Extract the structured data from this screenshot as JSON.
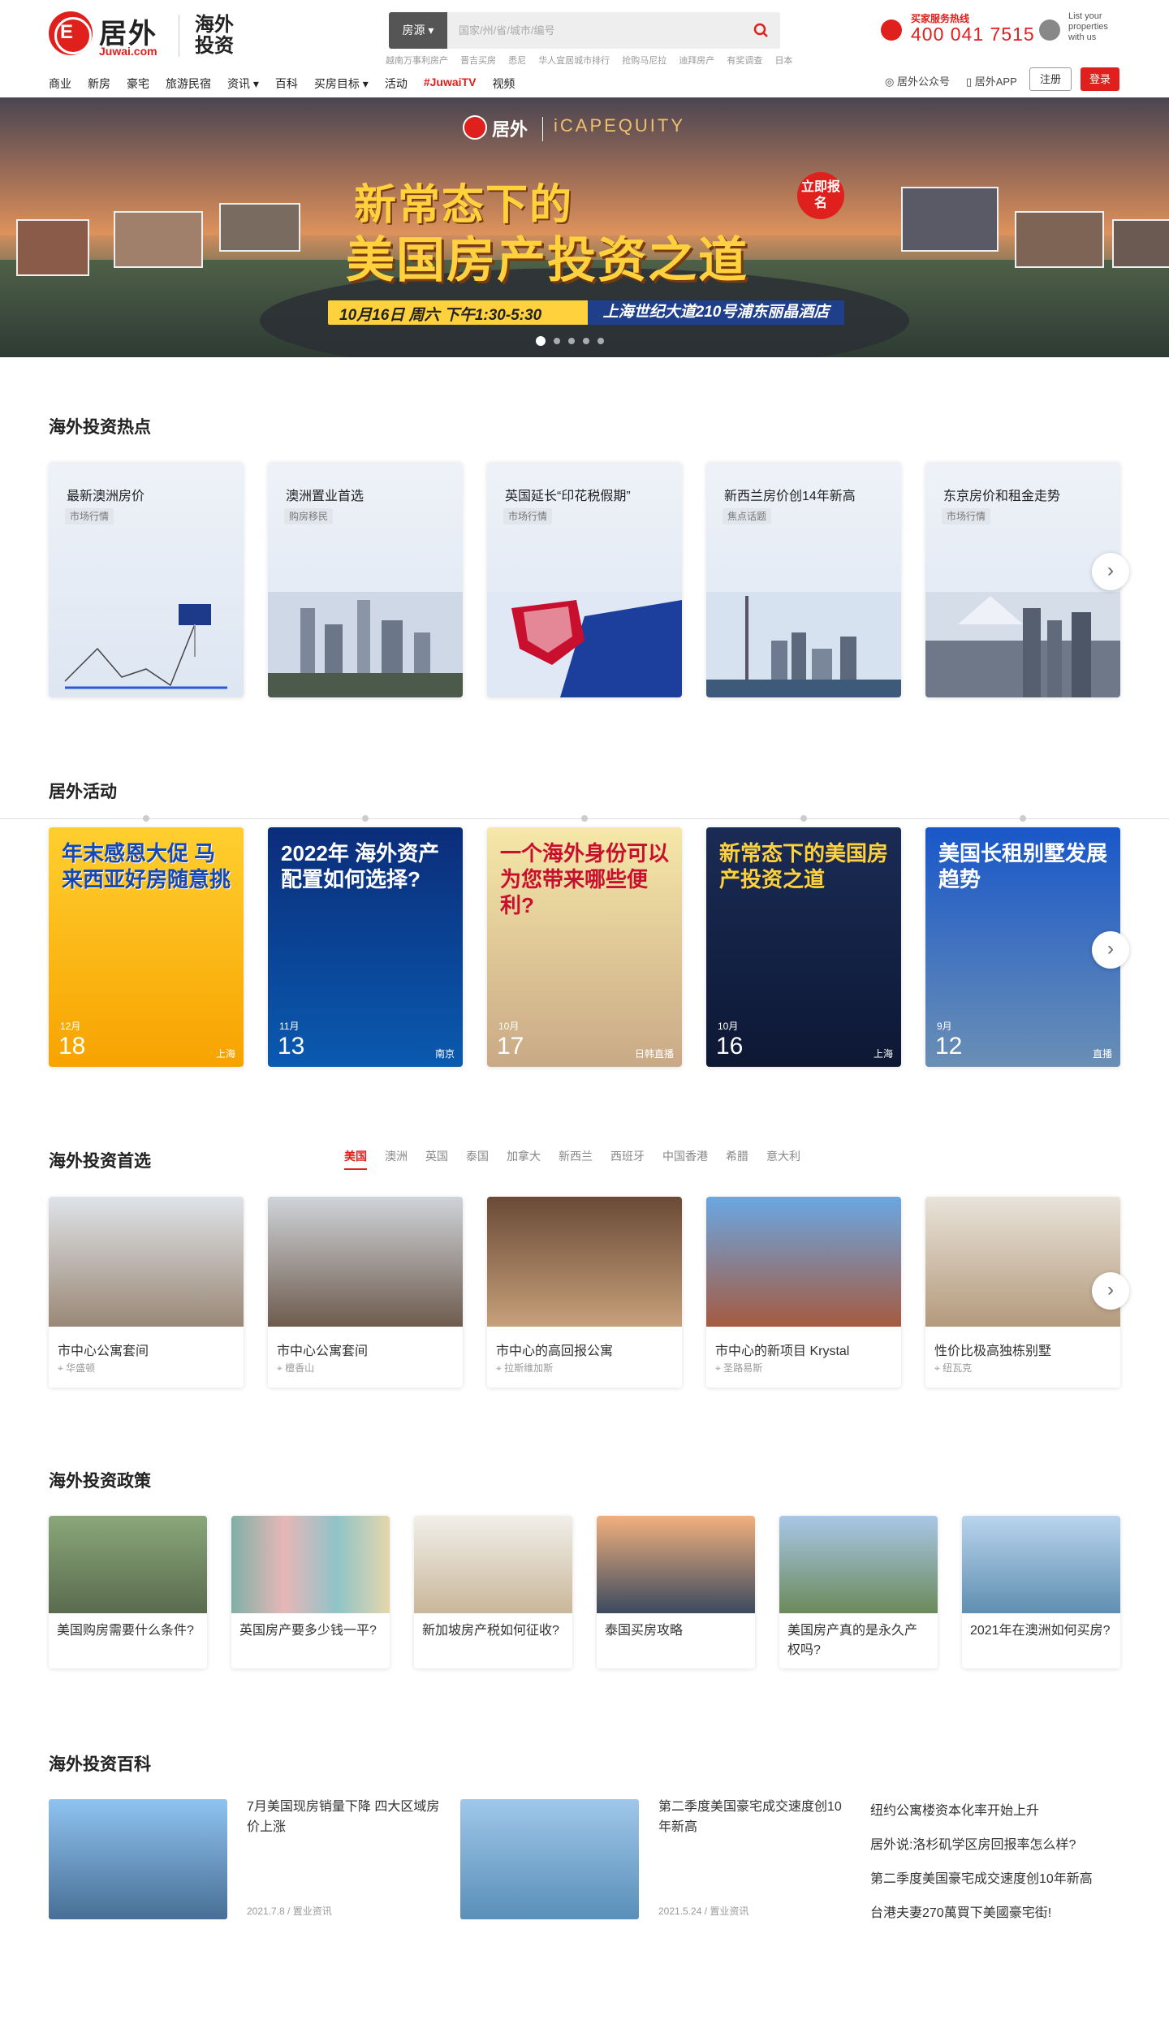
{
  "header": {
    "brand_name": "居外",
    "brand_domain": "Juwai.com",
    "brand_tagline": "海外投资",
    "search": {
      "type_label": "房源 ▾",
      "placeholder": "国家/州/省/城市/编号"
    },
    "hot_links": [
      "越南万事利房产",
      "晋吉买房",
      "悉尼",
      "华人宜居城市排行",
      "抢购马尼拉",
      "迪拜房产",
      "有奖调查",
      "日本"
    ],
    "hotline_label": "买家服务热线",
    "hotline_number": "400 041 7515",
    "list_property_text": "List your properties with us",
    "nav_items": [
      "商业",
      "新房",
      "豪宅",
      "旅游民宿",
      "资讯 ▾",
      "百科",
      "买房目标 ▾",
      "活动",
      "#JuwaiTV",
      "视频"
    ],
    "wechat_label": "居外公众号",
    "app_label": "居外APP",
    "register_label": "注册",
    "login_label": "登录"
  },
  "hero": {
    "logo_text": "居外",
    "partner_text": "iCAPEQUITY",
    "title_line1": "新常态下的",
    "title_line2": "美国房产投资之道",
    "badge": "立即报名",
    "date_text": "10月16日 周六 下午1:30-5:30",
    "venue_text": "上海世纪大道210号浦东丽晶酒店",
    "slides": 5,
    "active_slide": 1
  },
  "hot_section": {
    "title": "海外投资热点",
    "cards": [
      {
        "title": "最新澳洲房价",
        "tag": "市场行情"
      },
      {
        "title": "澳洲置业首选",
        "tag": "购房移民"
      },
      {
        "title": "英国延长“印花税假期”",
        "tag": "市场行情"
      },
      {
        "title": "新西兰房价创14年新高",
        "tag": "焦点话题"
      },
      {
        "title": "东京房价和租金走势",
        "tag": "市场行情"
      }
    ]
  },
  "activity_section": {
    "title": "居外活动",
    "cards": [
      {
        "text": "年末感恩大促 马来西亚好房随意挑",
        "month": "12月",
        "day": "18",
        "loc": "上海"
      },
      {
        "text": "2022年 海外资产配置如何选择?",
        "month": "11月",
        "day": "13",
        "loc": "南京"
      },
      {
        "text": "一个海外身份可以为您带来哪些便利?",
        "month": "10月",
        "day": "17",
        "loc": "日韩直播"
      },
      {
        "text": "新常态下的美国房产投资之道",
        "month": "10月",
        "day": "16",
        "loc": "上海"
      },
      {
        "text": "美国长租别墅发展趋势",
        "month": "9月",
        "day": "12",
        "loc": "直播"
      }
    ]
  },
  "pick_section": {
    "title": "海外投资首选",
    "tabs": [
      "美国",
      "澳洲",
      "英国",
      "泰国",
      "加拿大",
      "新西兰",
      "西班牙",
      "中国香港",
      "希腊",
      "意大利"
    ],
    "active_tab": 0,
    "cards": [
      {
        "title": "市中心公寓套间",
        "loc": "华盛顿"
      },
      {
        "title": "市中心公寓套间",
        "loc": "檀香山"
      },
      {
        "title": "市中心的高回报公寓",
        "loc": "拉斯维加斯"
      },
      {
        "title": "市中心的新项目 Krystal",
        "loc": "圣路易斯"
      },
      {
        "title": "性价比极高独栋别墅",
        "loc": "纽瓦克"
      }
    ]
  },
  "policy_section": {
    "title": "海外投资政策",
    "cards": [
      {
        "title": "美国购房需要什么条件?"
      },
      {
        "title": "英国房产要多少钱一平?"
      },
      {
        "title": "新加坡房产税如何征收?"
      },
      {
        "title": "泰国买房攻略"
      },
      {
        "title": "美国房产真的是永久产权吗?"
      },
      {
        "title": "2021年在澳洲如何买房?"
      }
    ]
  },
  "wiki_section": {
    "title": "海外投资百科",
    "articles": [
      {
        "title": "7月美国现房销量下降 四大区域房价上涨",
        "meta": "2021.7.8 / 置业资讯"
      },
      {
        "title": "第二季度美国豪宅成交速度创10年新高",
        "meta": "2021.5.24 / 置业资讯"
      }
    ],
    "links": [
      "纽约公寓楼资本化率开始上升",
      "居外说:洛杉矶学区房回报率怎么样?",
      "第二季度美国豪宅成交速度创10年新高",
      "台港夫妻270萬買下美國豪宅街!"
    ]
  }
}
